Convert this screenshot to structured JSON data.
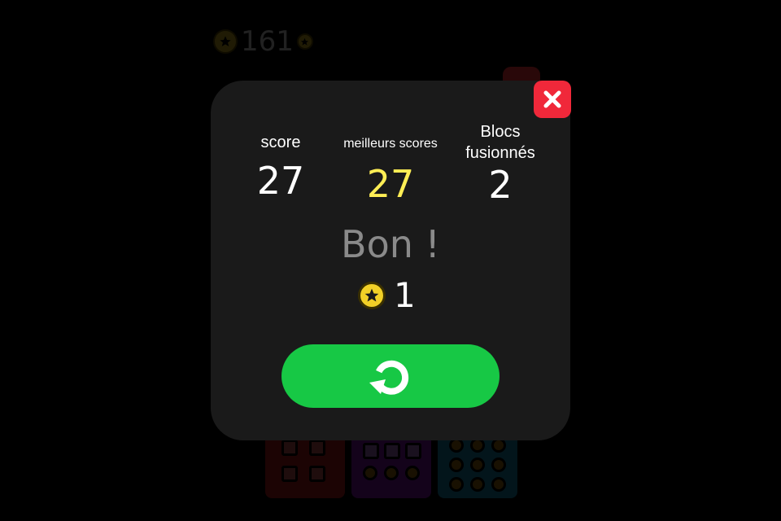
{
  "background": {
    "coin_count": "161",
    "icons": [
      "star-coin-icon",
      "star-coin-icon"
    ]
  },
  "modal": {
    "stats": {
      "score_label": "score",
      "score_value": "27",
      "best_label": "meilleurs scores",
      "best_value": "27",
      "merged_label_line1": "Blocs",
      "merged_label_line2": "fusionnés",
      "merged_value": "2"
    },
    "rating": "Bon !",
    "reward": {
      "icon": "star-coin-icon",
      "count": "1"
    },
    "buttons": {
      "close_icon": "close-icon",
      "restart_icon": "restart-icon"
    }
  },
  "colors": {
    "modal_bg": "#1a1a1a",
    "close_red": "#f0283a",
    "restart_green": "#17c845",
    "best_score_yellow": "#ffee55",
    "rating_gray": "#8a8a8a",
    "coin_gold": "#f2d027"
  }
}
